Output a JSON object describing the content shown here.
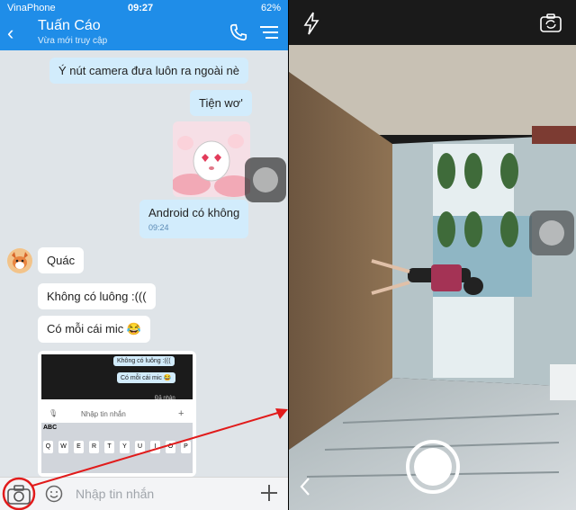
{
  "status": {
    "carrier": "VinaPhone",
    "time": "09:27",
    "battery": "62%"
  },
  "header": {
    "contact_name": "Tuấn Cáo",
    "presence": "Vừa mới truy cập"
  },
  "messages": {
    "m1": "Ý nút camera đưa luôn ra ngoài nè",
    "m2": "Tiện wơ'",
    "m3": "Android có không",
    "m3_time": "09:24",
    "m4": "Quác",
    "m5": "Không có luông :(((",
    "m6": "Có mỗi cái mic 😂"
  },
  "embedded_screenshot": {
    "msg1": "Không có luông :(((",
    "msg2": "Có mỗi cái mic 😂",
    "received": "Đã nhận",
    "input_placeholder": "Nhập tin nhắn",
    "abc_key": "ABC",
    "keys_row": [
      "Q",
      "W",
      "E",
      "R",
      "T",
      "Y",
      "U",
      "I",
      "O",
      "P"
    ]
  },
  "composer": {
    "placeholder": "Nhập tin nhắn"
  },
  "colors": {
    "header_blue": "#1f8de8",
    "outgoing_bubble": "#d2ecfc",
    "annotation_red": "#e11b1b"
  }
}
